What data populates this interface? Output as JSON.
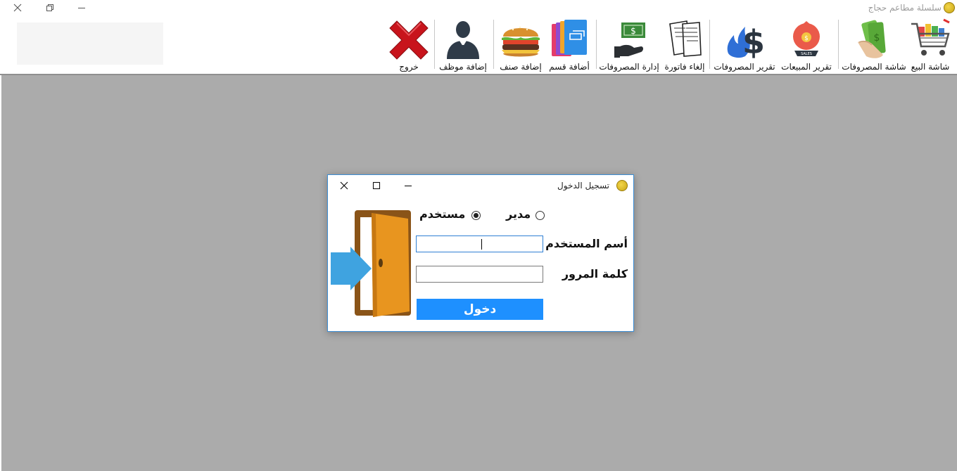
{
  "window": {
    "title": "سلسلة مطاعم حجاج"
  },
  "toolbar": {
    "items": [
      {
        "label": "شاشة البيع",
        "icon": "shopping-cart-icon"
      },
      {
        "label": "شاشة المصروفات",
        "icon": "cash-in-hand-icon"
      },
      {
        "label": "تقرير المبيعات",
        "icon": "sales-bag-icon"
      },
      {
        "label": "تقرير المصروفات",
        "icon": "dollar-fire-icon"
      },
      {
        "label": "إلغاء فاتورة",
        "icon": "invoice-papers-icon"
      },
      {
        "label": "إدارة المصروفات",
        "icon": "money-hand-icon"
      },
      {
        "label": "أضافة قسم",
        "icon": "color-folders-icon"
      },
      {
        "label": "إضافة صنف",
        "icon": "burger-icon"
      },
      {
        "label": "إضافة موظف",
        "icon": "employee-icon"
      },
      {
        "label": "خروج",
        "icon": "red-x-icon"
      }
    ]
  },
  "login": {
    "title": "تسجيل الدخول",
    "role_manager": "مدير",
    "role_user": "مستخدم",
    "selected_role": "مستخدم",
    "username_label": "أسم المستخدم",
    "username_value": "",
    "password_label": "كلمة المرور",
    "password_value": "",
    "submit_label": "دخول"
  },
  "colors": {
    "accent": "#1e90ff",
    "workspace": "#ababab",
    "door": "#e8951f",
    "arrow": "#3fa3e0",
    "exit": "#c8141c"
  }
}
